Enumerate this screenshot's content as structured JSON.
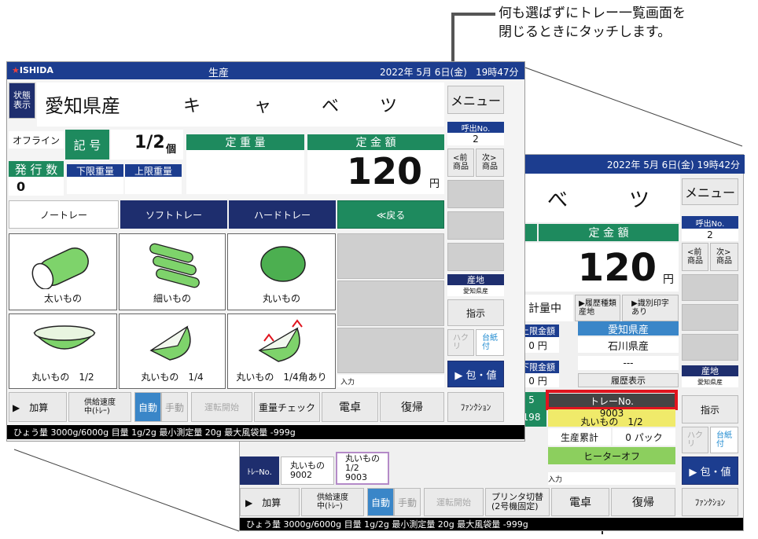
{
  "annotation": {
    "line1": "何も選ばずにトレー一覧画面を",
    "line2": "閉じるときにタッチします。",
    "bottom_label": "トレーNo."
  },
  "front": {
    "brand": "ISHIDA",
    "title": "生産",
    "datetime": "2022年 5月 6日(金)",
    "time": "19時47分",
    "state_btn": "状態\n表示",
    "product": "愛知県産",
    "product_kana": [
      "キ",
      "ャ",
      "ベ",
      "ツ"
    ],
    "menu": "メニュー",
    "call_no_label": "呼出No.",
    "call_no": "2",
    "offline": "オフライン",
    "symbol_label": "記 号",
    "symbol_value": "1/2",
    "symbol_unit": "個",
    "fixed_weight": "定 重 量",
    "fixed_price": "定 金 額",
    "issue_count_label": "発 行 数",
    "issue_count": "0",
    "lower_weight": "下限重量",
    "upper_weight": "上限重量",
    "price": "120",
    "yen": "円",
    "prev_product": "<前\n商品",
    "next_product": "次>\n商品",
    "tabs": [
      "ノートレー",
      "ソフトトレー",
      "ハードトレー",
      "≪戻る"
    ],
    "tiles": [
      "太いもの",
      "細いもの",
      "丸いもの",
      "丸いもの　1/2",
      "丸いもの　1/4",
      "丸いもの　1/4角あり"
    ],
    "origin_label": "産地",
    "origin_value": "愛知県産",
    "instruct": "指示",
    "hakugami": "ハク\nリ",
    "daishi": "台紙\n付",
    "wrap": "▶ 包・値",
    "input_label": "入力",
    "bottom": {
      "add": "▶　加算",
      "feed": "供給速度\n中(ﾄﾚｰ)",
      "auto": "自動",
      "manual": "手動",
      "start": "運転開始",
      "weight_check": "重量チェック",
      "calc": "電卓",
      "restore": "復帰",
      "function": "ﾌｧﾝｸｼｮﾝ"
    },
    "status": "ひょう量 3000g/6000g  目量 1g/2g  最小測定量 20g  最大風袋量 -999g"
  },
  "back": {
    "datetime": "2022年 5月 6日(金) 19時42分",
    "kana": [
      "べ",
      "ツ"
    ],
    "menu": "メニュー",
    "call_no_label": "呼出No.",
    "call_no": "2",
    "fixed_price": "定 金 額",
    "price": "120",
    "yen": "円",
    "prev_product": "<前\n商品",
    "next_product": "次>\n商品",
    "weighing": "計量中",
    "history": "▶履歴種類\n産地",
    "ident": "▶識別印字\nあり",
    "origin1": "愛知県産",
    "origin2": "石川県産",
    "dash": "---",
    "upper_price": "上限金額",
    "upper_value": "0 円",
    "lower_price": "下限金額",
    "lower_value": "0 円",
    "history_disp": "履歴表示",
    "tray_no": "トレーNo.",
    "tray_detail": "丸いもの　1/2",
    "tray_code": "9003",
    "cum": "生産累計",
    "packs": "0 パック",
    "heater": "ヒーターオフ",
    "left_num1": "5",
    "left_num2": "198",
    "origin_label": "産地",
    "origin_value": "愛知県産",
    "instruct": "指示",
    "hakugami": "ハク\nリ",
    "daishi": "台紙\n付",
    "wrap": "▶ 包・値",
    "tray_tab": "ﾄﾚｰNo.",
    "tray1": "丸いもの\n9002",
    "tray2": "丸いもの\n1/2\n9003",
    "input_label": "入力",
    "bottom": {
      "add": "▶　加算",
      "feed": "供給速度\n中(ﾄﾚｰ)",
      "auto": "自動",
      "manual": "手動",
      "start": "運転開始",
      "printer": "プリンタ切替\n(2号機固定)",
      "calc": "電卓",
      "restore": "復帰",
      "function": "ﾌｧﾝｸｼｮﾝ"
    },
    "status": "ひょう量 3000g/6000g  目量 1g/2g  最小測定量 20g  最大風袋量 -999g"
  }
}
